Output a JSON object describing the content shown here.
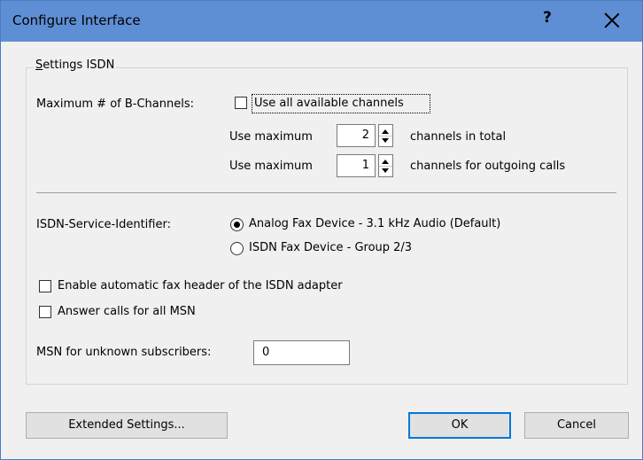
{
  "window": {
    "title": "Configure Interface",
    "help_label": "?",
    "close_label": "×"
  },
  "group": {
    "legend": "Settings ISDN"
  },
  "b_channels": {
    "label": "Maximum # of B-Channels:",
    "use_all_label": "Use all available channels",
    "use_all_checked": false,
    "total": {
      "prefix": "Use maximum",
      "value": "2",
      "suffix": "channels in total"
    },
    "outgoing": {
      "prefix": "Use maximum",
      "value": "1",
      "suffix": "channels for outgoing calls"
    }
  },
  "service_identifier": {
    "label": "ISDN-Service-Identifier:",
    "options": [
      {
        "label": "Analog Fax Device - 3.1 kHz Audio (Default)",
        "selected": true
      },
      {
        "label": "ISDN Fax Device - Group 2/3",
        "selected": false
      }
    ]
  },
  "checkboxes": {
    "fax_header": {
      "label": "Enable automatic fax header of the ISDN adapter",
      "checked": false
    },
    "answer_all": {
      "label": "Answer calls for all MSN",
      "checked": false
    }
  },
  "msn": {
    "label": "MSN for unknown subscribers:",
    "value": "0"
  },
  "buttons": {
    "extended": "Extended Settings...",
    "ok": "OK",
    "cancel": "Cancel"
  },
  "colors": {
    "titlebar": "#5e8fd4",
    "dialog_bg": "#f0f0f0",
    "default_button_border": "#0078d7"
  }
}
